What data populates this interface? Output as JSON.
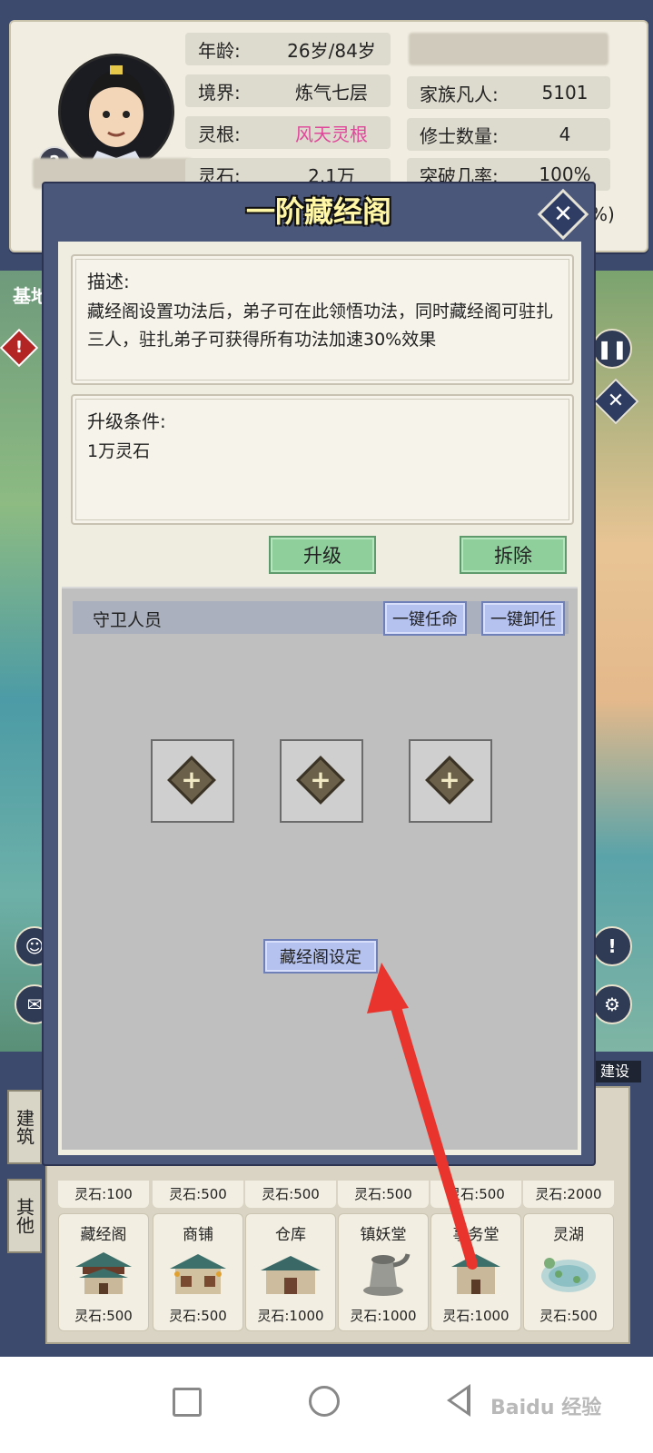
{
  "profile": {
    "age_label": "年龄:",
    "age_value": "26岁/84岁",
    "realm_label": "境界:",
    "realm_value": "炼气七层",
    "root_label": "灵根:",
    "root_value": "风天灵根",
    "stone_label": "灵石:",
    "stone_value": "2.1万",
    "family_label": "家族凡人:",
    "family_value": "5101",
    "cultivator_label": "修士数量:",
    "cultivator_value": "4",
    "breakthrough_label": "突破几率:",
    "breakthrough_value": "100%",
    "help_icon": "?",
    "partial_right": "%)"
  },
  "map": {
    "left_label": "基地",
    "warn_icon": "!",
    "pause_icon": "pause-icon",
    "close_icon": "x-icon"
  },
  "dialog": {
    "title": "一阶藏经阁",
    "close_icon": "✕",
    "desc_title": "描述:",
    "desc_text": "藏经阁设置功法后，弟子可在此领悟功法，同时藏经阁可驻扎三人，驻扎弟子可获得所有功法加速30%效果",
    "req_title": "升级条件:",
    "req_text": "1万灵石",
    "upgrade_btn": "升级",
    "demolish_btn": "拆除",
    "guard_label": "守卫人员",
    "appoint_all_btn": "一键任命",
    "dismiss_all_btn": "一键卸任",
    "slot_plus": "+",
    "settings_btn": "藏经阁设定"
  },
  "shelf": {
    "tabs": [
      "建筑",
      "其他"
    ],
    "build_tag": "建设",
    "top_row_costs": [
      "灵石:100",
      "灵石:500",
      "灵石:500",
      "灵石:500",
      "灵石:500",
      "灵石:2000"
    ],
    "cards": [
      {
        "name": "藏经阁",
        "cost": "灵石:500"
      },
      {
        "name": "商铺",
        "cost": "灵石:500"
      },
      {
        "name": "仓库",
        "cost": "灵石:1000"
      },
      {
        "name": "镇妖堂",
        "cost": "灵石:1000"
      },
      {
        "name": "事务堂",
        "cost": "灵石:1000"
      },
      {
        "name": "灵湖",
        "cost": "灵石:500"
      }
    ]
  },
  "navbar": {
    "watermark": "Baidu 经验"
  },
  "colors": {
    "accent_pink": "#e0479a",
    "arrow_red": "#e8342c",
    "dialog_bg": "#4b567b"
  }
}
